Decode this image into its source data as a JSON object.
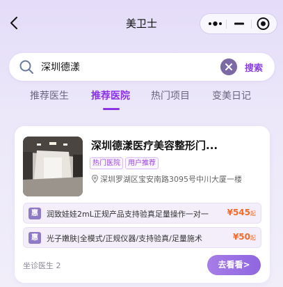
{
  "nav": {
    "title": "美卫士"
  },
  "search": {
    "value": "深圳德漾",
    "button_label": "搜索"
  },
  "tabs": [
    {
      "label": "推荐医生",
      "active": false
    },
    {
      "label": "推荐医院",
      "active": true
    },
    {
      "label": "热门项目",
      "active": false
    },
    {
      "label": "变美日记",
      "active": false
    }
  ],
  "hospital": {
    "name": "深圳德漾医疗美容整形门...",
    "tags": [
      "热门医院",
      "用户推荐"
    ],
    "address": "深圳罗湖区宝安南路3095号中川大厦一楼",
    "deals": [
      {
        "badge": "惠",
        "text": "润致娃娃2mL正规产品支持验真足量操作一对一",
        "price": "¥545",
        "suffix": "起"
      },
      {
        "badge": "惠",
        "text": "光子嫩肤|全模式/正规仪器/支持验真/足量施术",
        "price": "¥50",
        "suffix": "起"
      }
    ],
    "doctor_count": "坐诊医生 2",
    "cta_label": "去看看>"
  },
  "colors": {
    "accent": "#8a34e6",
    "price": "#f06a2a",
    "tag": "#9a45e0"
  }
}
